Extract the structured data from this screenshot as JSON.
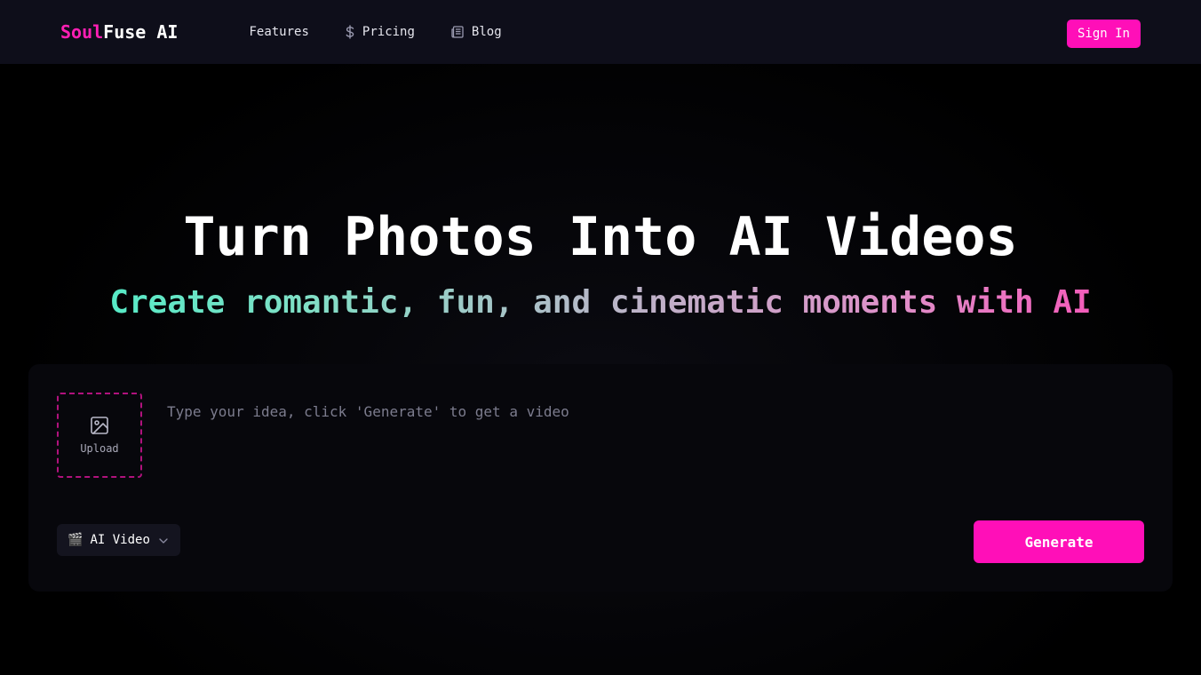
{
  "header": {
    "logo_part1": "Soul",
    "logo_part2": "Fuse AI",
    "nav": [
      {
        "label": "Features",
        "icon": ""
      },
      {
        "label": "Pricing",
        "icon": "dollar-icon"
      },
      {
        "label": "Blog",
        "icon": "newspaper-icon"
      }
    ],
    "signin_label": "Sign In"
  },
  "hero": {
    "title": "Turn Photos Into AI Videos",
    "subtitle": "Create romantic, fun, and cinematic moments with AI"
  },
  "generator": {
    "upload_label": "Upload",
    "upload_icon": "image-icon",
    "prompt_placeholder": "Type your idea, click 'Generate' to get a video",
    "prompt_value": "",
    "model_emoji": "🎬",
    "model_label": "AI Video",
    "generate_label": "Generate"
  },
  "colors": {
    "accent": "#ff0fb8",
    "header_bg": "#0e0e1a",
    "panel_bg": "#07070c"
  }
}
